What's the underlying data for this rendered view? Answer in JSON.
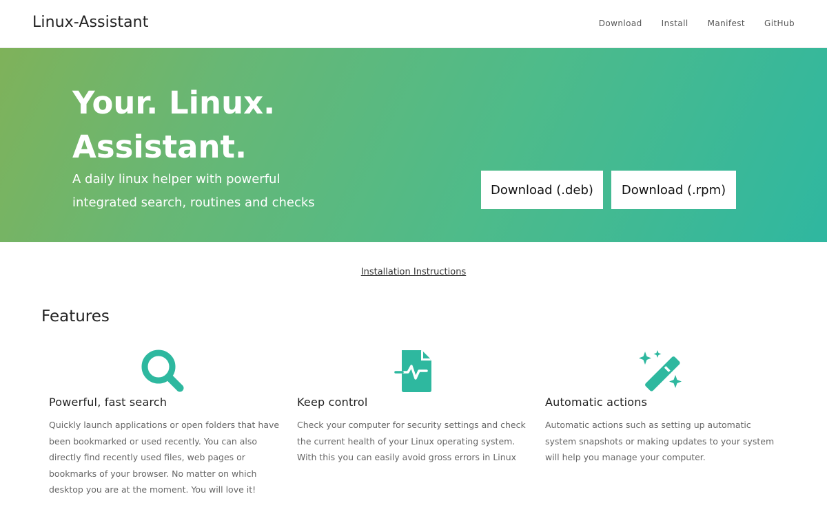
{
  "nav": {
    "brand": "Linux-Assistant",
    "links": [
      "Download",
      "Install",
      "Manifest",
      "GitHub"
    ]
  },
  "hero": {
    "title": "Your. Linux. Assistant.",
    "subtitle": "A daily linux helper with powerful integrated search, routines and checks",
    "buttons": [
      "Download (.deb)",
      "Download (.rpm)"
    ],
    "gradient_start": "#7fb25a",
    "gradient_end": "#2fb7a0"
  },
  "install_link": "Installation Instructions",
  "features_title": "Features",
  "accent_color": "#2eb89f",
  "features": [
    {
      "icon": "search-icon",
      "title": "Powerful, fast search",
      "text": "Quickly launch applications or open folders that have been bookmarked or used recently. You can also directly find recently used files, web pages or bookmarks of your browser. No matter on which desktop you are at the moment. You will love it!"
    },
    {
      "icon": "file-health-icon",
      "title": "Keep control",
      "text": "Check your computer for security settings and check the current health of your Linux operating system. With this you can easily avoid gross errors in Linux"
    },
    {
      "icon": "magic-wand-icon",
      "title": "Automatic actions",
      "text": "Automatic actions such as setting up automatic system snapshots or making updates to your system will help you manage your computer."
    }
  ]
}
